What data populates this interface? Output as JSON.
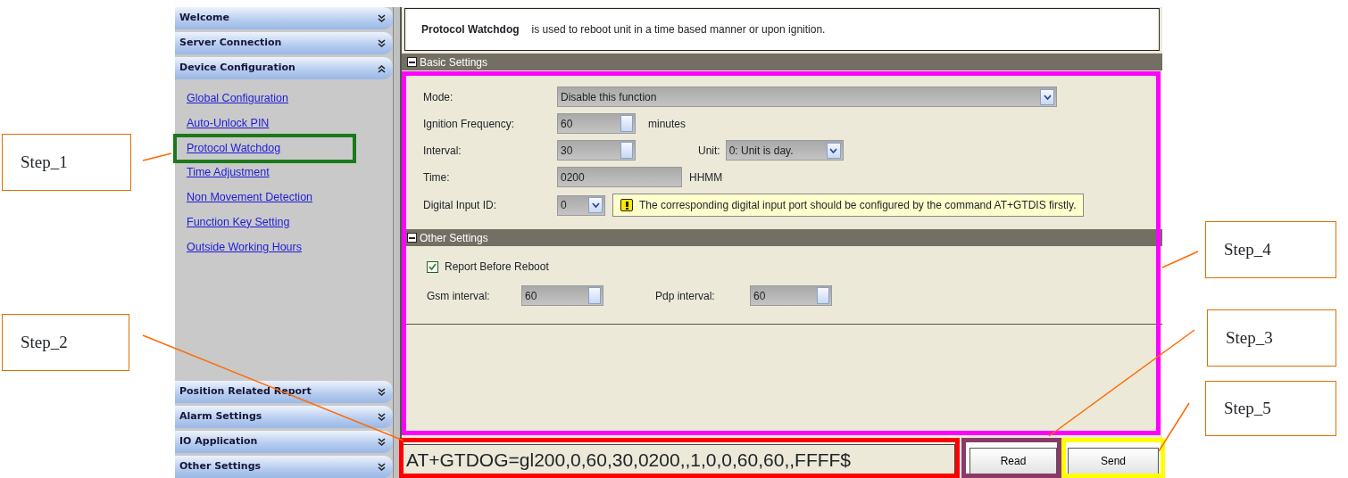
{
  "sidebar": {
    "sections": [
      {
        "title": "Welcome",
        "expanded": false
      },
      {
        "title": "Server Connection",
        "expanded": false
      },
      {
        "title": "Device Configuration",
        "expanded": true,
        "items": [
          {
            "label": "Global Configuration"
          },
          {
            "label": "Auto-Unlock PIN"
          },
          {
            "label": "Protocol Watchdog"
          },
          {
            "label": "Time Adjustment"
          },
          {
            "label": "Non Movement Detection"
          },
          {
            "label": "Function Key Setting"
          },
          {
            "label": "Outside Working Hours"
          }
        ]
      },
      {
        "title": "Position Related Report",
        "expanded": false
      },
      {
        "title": "Alarm Settings",
        "expanded": false
      },
      {
        "title": "IO Application",
        "expanded": false
      },
      {
        "title": "Other Settings",
        "expanded": false
      }
    ]
  },
  "description": {
    "title": "Protocol Watchdog",
    "text": "is used to reboot unit in a time based manner or upon ignition."
  },
  "basic_settings": {
    "title": "Basic Settings",
    "fields": [
      {
        "kind": "select",
        "label": "Mode:",
        "value": "Disable this function"
      },
      {
        "kind": "spin",
        "label": "Ignition Frequency:",
        "value": "60",
        "suffix": "minutes"
      },
      {
        "kind": "spin",
        "label": "Interval:",
        "value": "30",
        "unit_label": "Unit:",
        "unit_value": "0: Unit is day."
      },
      {
        "kind": "text",
        "label": "Time:",
        "value": "0200",
        "suffix": "HHMM"
      },
      {
        "kind": "small_select",
        "label": "Digital Input ID:",
        "value": "0",
        "note": "The corresponding digital input port should be configured by the command AT+GTDIS firstly."
      }
    ]
  },
  "other_settings": {
    "title": "Other Settings",
    "report_before_reboot": {
      "label": "Report Before Reboot",
      "checked": true
    },
    "intervals": [
      {
        "label": "Gsm interval:",
        "value": "60"
      },
      {
        "label": "Pdp interval:",
        "value": "60"
      }
    ]
  },
  "command": {
    "value": "AT+GTDOG=gl200,0,60,30,0200,,1,0,0,60,60,,FFFF$"
  },
  "buttons": [
    "Read",
    "Send"
  ],
  "callouts": [
    "Step_1",
    "Step_2",
    "Step_4",
    "Step_3",
    "Step_5"
  ]
}
